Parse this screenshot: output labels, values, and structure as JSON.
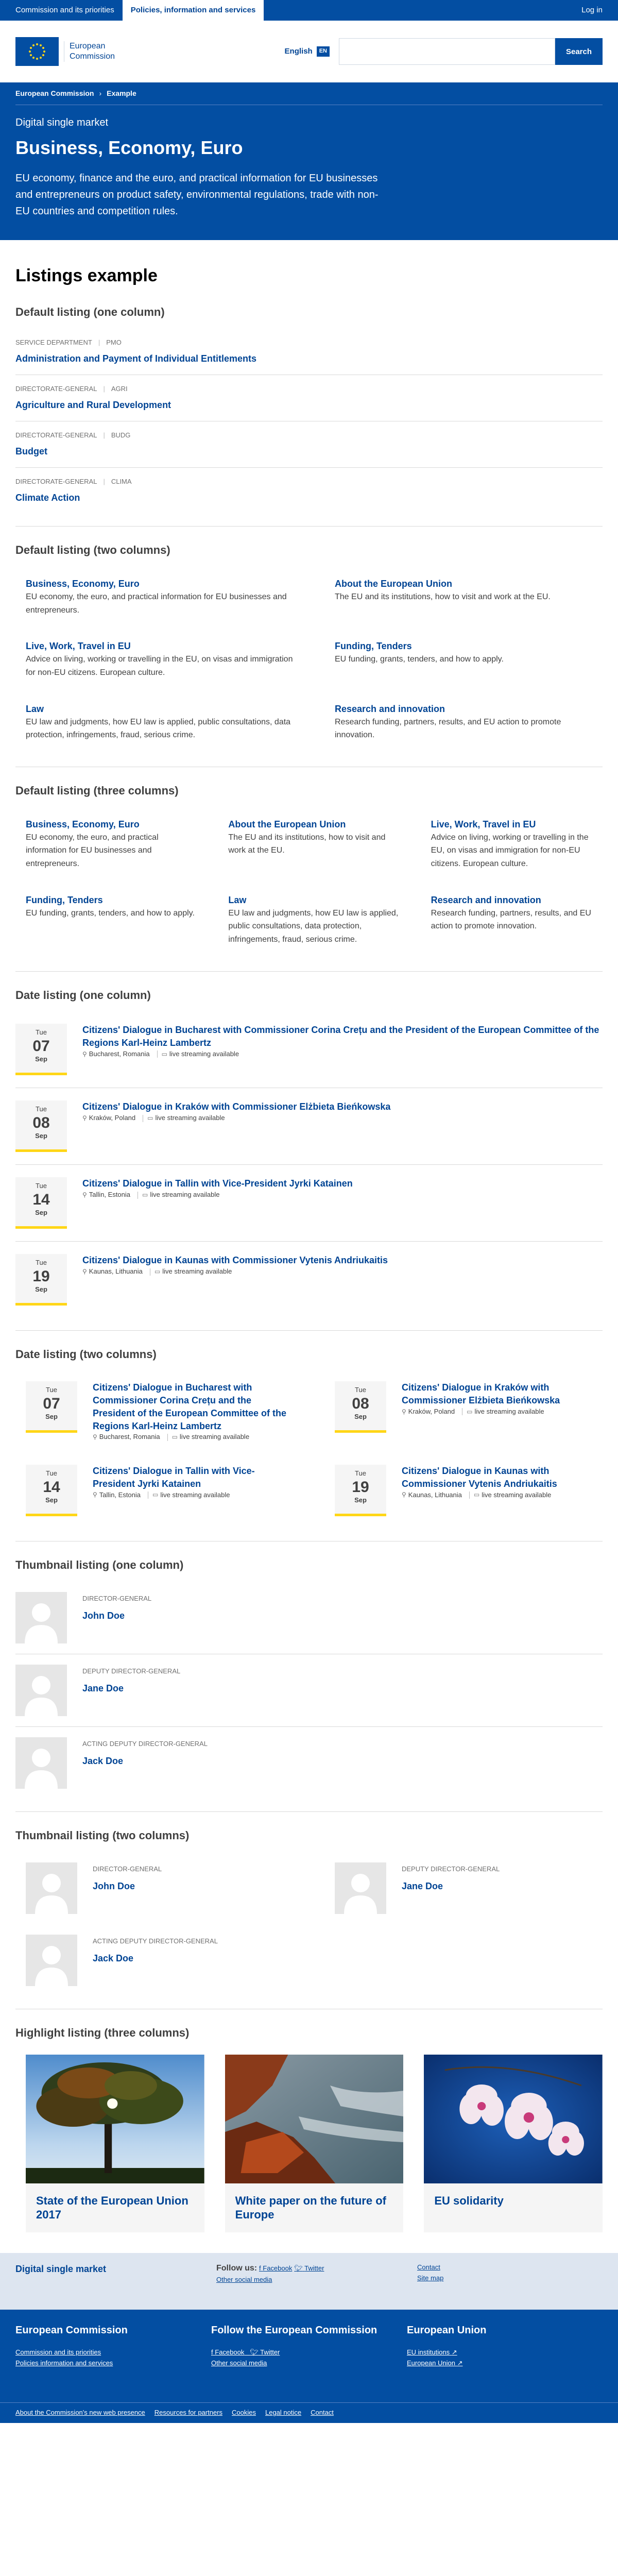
{
  "topnav": {
    "items": [
      "Commission and its priorities",
      "Policies, information and services"
    ],
    "login": "Log in"
  },
  "header": {
    "logo_line1": "European",
    "logo_line2": "Commission",
    "language": "English",
    "language_code": "EN",
    "search_placeholder": "",
    "search_button": "Search"
  },
  "breadcrumb": [
    "European Commission",
    "Example"
  ],
  "page": {
    "meta": "Digital single market",
    "title": "Business, Economy, Euro",
    "intro": "EU economy, finance and the euro, and practical information for EU businesses and entrepreneurs on product safety, environmental regulations, trade with non-EU countries and competition rules."
  },
  "listings_title": "Listings example",
  "default_one": {
    "title": "Default listing (one column)",
    "items": [
      {
        "meta1": "Service department",
        "meta2": "PMO",
        "title": "Administration and Payment of Individual Entitlements"
      },
      {
        "meta1": "Directorate-general",
        "meta2": "AGRI",
        "title": "Agriculture and Rural Development"
      },
      {
        "meta1": "Directorate-general",
        "meta2": "BUDG",
        "title": "Budget"
      },
      {
        "meta1": "Directorate-general",
        "meta2": "CLIMA",
        "title": "Climate Action"
      }
    ]
  },
  "default_two": {
    "title": "Default listing (two columns)",
    "items": [
      {
        "title": "Business, Economy, Euro",
        "desc": "EU economy, the euro, and practical information for EU businesses and entrepreneurs."
      },
      {
        "title": "About the European Union",
        "desc": "The EU and its institutions, how to visit and work at the EU."
      },
      {
        "title": "Live, Work, Travel in EU",
        "desc": "Advice on living, working or travelling in the EU, on visas and immigration for non-EU citizens. European culture."
      },
      {
        "title": "Funding, Tenders",
        "desc": "EU funding, grants, tenders, and how to apply."
      },
      {
        "title": "Law",
        "desc": "EU law and judgments, how EU law is applied, public consultations, data protection, infringements, fraud, serious crime."
      },
      {
        "title": "Research and innovation",
        "desc": "Research funding, partners, results, and EU action to promote innovation."
      }
    ]
  },
  "default_three": {
    "title": "Default listing (three columns)",
    "items": [
      {
        "title": "Business, Economy, Euro",
        "desc": "EU economy, the euro, and practical information for EU businesses and entrepreneurs."
      },
      {
        "title": "About the European Union",
        "desc": "The EU and its institutions, how to visit and work at the EU."
      },
      {
        "title": "Live, Work, Travel in EU",
        "desc": "Advice on living, working or travelling in the EU, on visas and immigration for non-EU citizens. European culture."
      },
      {
        "title": "Funding, Tenders",
        "desc": "EU funding, grants, tenders, and how to apply."
      },
      {
        "title": "Law",
        "desc": "EU law and judgments, how EU law is applied, public consultations, data protection, infringements, fraud, serious crime."
      },
      {
        "title": "Research and innovation",
        "desc": "Research funding, partners, results, and EU action to promote innovation."
      }
    ]
  },
  "date_one": {
    "title": "Date listing (one column)",
    "streaming": "live streaming available",
    "items": [
      {
        "dow": "Tue",
        "day": "07",
        "mon": "Sep",
        "title": "Citizens' Dialogue in Bucharest with Commissioner Corina Crețu and the President of the European Committee of the Regions Karl-Heinz Lambertz",
        "place": "Bucharest, Romania"
      },
      {
        "dow": "Tue",
        "day": "08",
        "mon": "Sep",
        "title": "Citizens' Dialogue in Kraków with Commissioner Elżbieta Bieńkowska",
        "place": "Kraków, Poland"
      },
      {
        "dow": "Tue",
        "day": "14",
        "mon": "Sep",
        "title": "Citizens' Dialogue in Tallin with Vice-President Jyrki Katainen",
        "place": "Tallin, Estonia"
      },
      {
        "dow": "Tue",
        "day": "19",
        "mon": "Sep",
        "title": "Citizens' Dialogue in Kaunas with Commissioner Vytenis Andriukaitis",
        "place": "Kaunas, Lithuania"
      }
    ]
  },
  "date_two": {
    "title": "Date listing (two columns)",
    "streaming": "live streaming available",
    "items": [
      {
        "dow": "Tue",
        "day": "07",
        "mon": "Sep",
        "title": "Citizens' Dialogue in Bucharest with Commissioner Corina Crețu and the President of the European Committee of the Regions Karl-Heinz Lambertz",
        "place": "Bucharest, Romania"
      },
      {
        "dow": "Tue",
        "day": "08",
        "mon": "Sep",
        "title": "Citizens' Dialogue in Kraków with Commissioner Elżbieta Bieńkowska",
        "place": "Kraków, Poland"
      },
      {
        "dow": "Tue",
        "day": "14",
        "mon": "Sep",
        "title": "Citizens' Dialogue in Tallin with Vice-President Jyrki Katainen",
        "place": "Tallin, Estonia"
      },
      {
        "dow": "Tue",
        "day": "19",
        "mon": "Sep",
        "title": "Citizens' Dialogue in Kaunas with Commissioner Vytenis Andriukaitis",
        "place": "Kaunas, Lithuania"
      }
    ]
  },
  "thumb_one": {
    "title": "Thumbnail listing (one column)",
    "items": [
      {
        "role": "Director-General",
        "name": "John Doe"
      },
      {
        "role": "Deputy Director-General",
        "name": "Jane Doe"
      },
      {
        "role": "Acting Deputy Director-General",
        "name": "Jack Doe"
      }
    ]
  },
  "thumb_two": {
    "title": "Thumbnail listing (two columns)",
    "items": [
      {
        "role": "Director-General",
        "name": "John Doe"
      },
      {
        "role": "Deputy Director-General",
        "name": "Jane Doe"
      },
      {
        "role": "Acting Deputy Director-General",
        "name": "Jack Doe"
      }
    ]
  },
  "highlight": {
    "title": "Highlight listing (three columns)",
    "items": [
      {
        "title": "State of the European Union 2017",
        "image": "tree-sunset-image"
      },
      {
        "title": "White paper on the future of Europe",
        "image": "coast-rocks-image"
      },
      {
        "title": "EU solidarity",
        "image": "orchid-image"
      }
    ]
  },
  "footer": {
    "site_name": "Digital single market",
    "follow_label": "Follow us:",
    "facebook": "Facebook",
    "twitter": "Twitter",
    "other_social": "Other social media",
    "contact": "Contact",
    "site_map": "Site map",
    "col1_title": "European Commission",
    "col1_links": [
      "Commission and its priorities",
      "Policies information and services"
    ],
    "col2_title": "Follow the European Commission",
    "col3_title": "European Union",
    "col3_links": [
      "EU institutions",
      "European Union"
    ],
    "bottom_links": [
      "About the Commission's new web presence",
      "Resources for partners",
      "Cookies",
      "Legal notice",
      "Contact"
    ]
  },
  "colors": {
    "brand_blue": "#034ea2",
    "link_blue": "#004494",
    "accent_yellow": "#ffd617"
  }
}
